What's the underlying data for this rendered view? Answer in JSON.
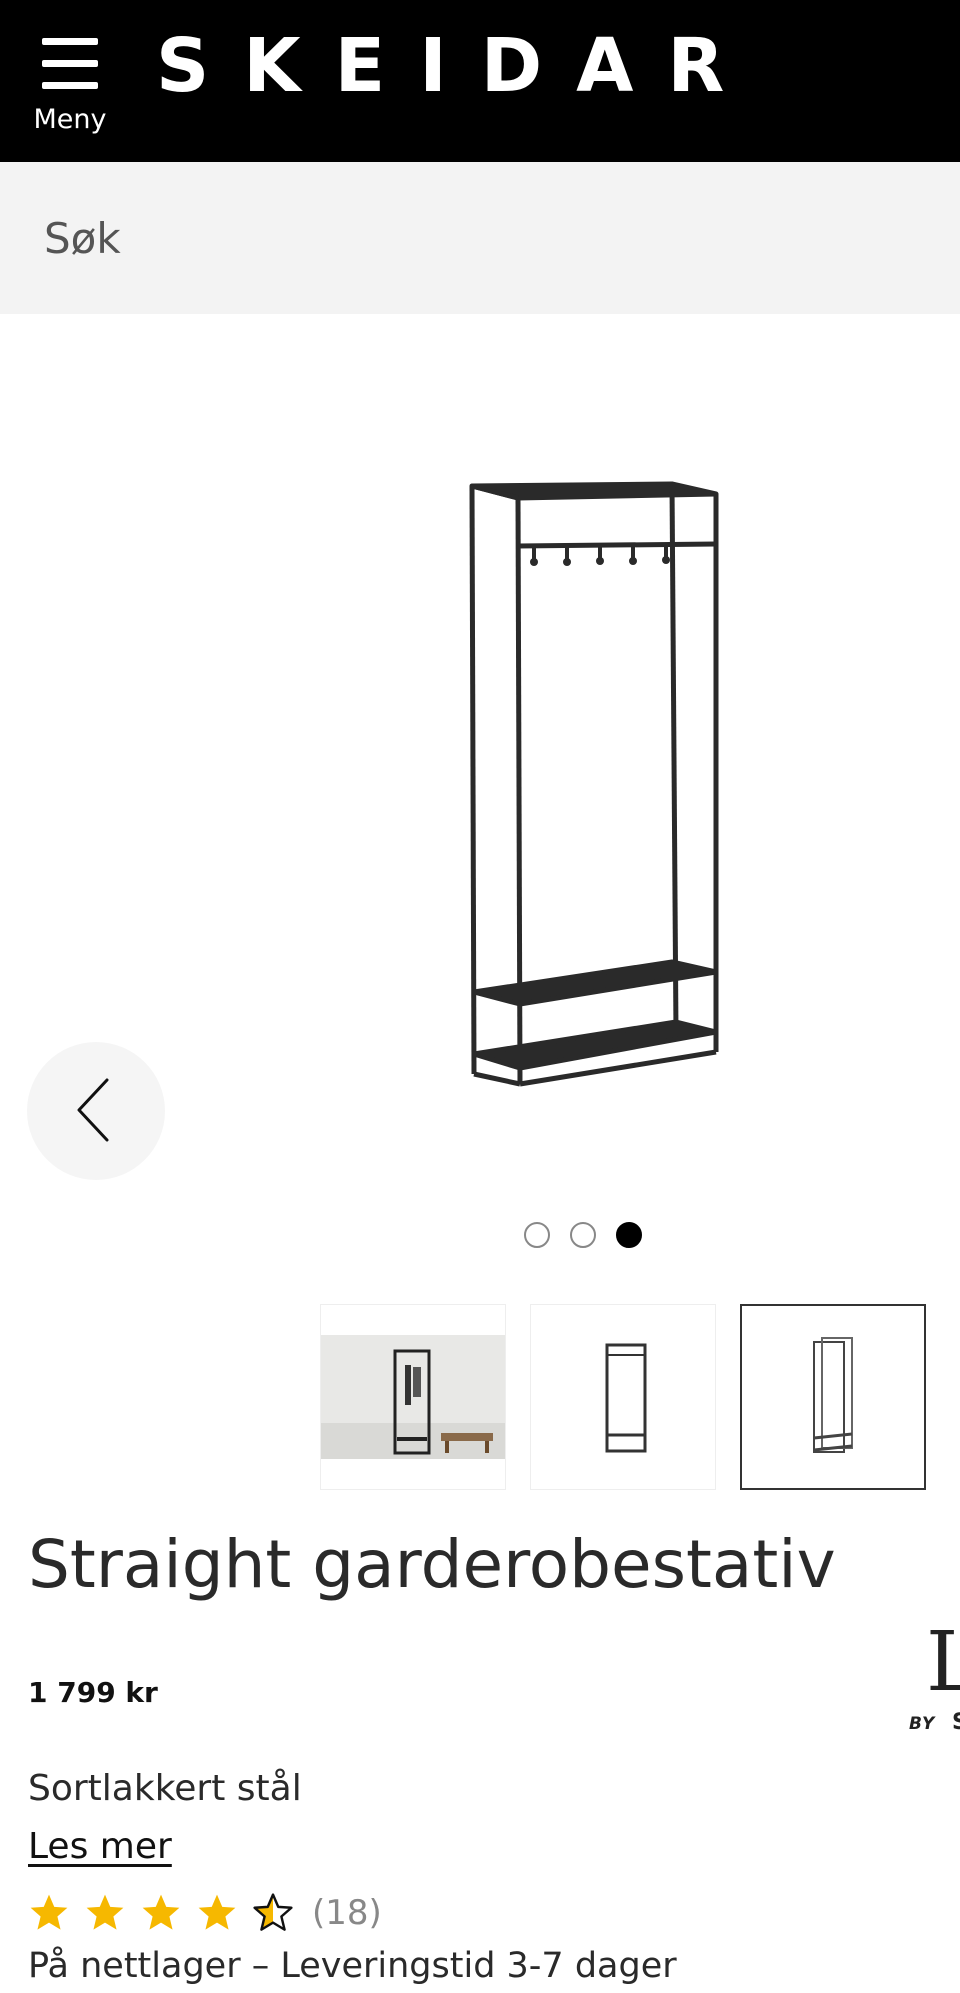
{
  "header": {
    "menu_label": "Meny",
    "logo": "SKEIDAR",
    "background": "#000000",
    "text_color": "#ffffff"
  },
  "search": {
    "placeholder": "Søk",
    "background": "#f3f3f3"
  },
  "gallery": {
    "image_count": 3,
    "active_index": 3,
    "prev_icon": "chevron-left-icon",
    "thumbnails": [
      {
        "name": "thumb-room-scene",
        "selected": false
      },
      {
        "name": "thumb-front-view",
        "selected": false
      },
      {
        "name": "thumb-angled-view",
        "selected": true
      }
    ]
  },
  "product": {
    "title": "Straight garderobestativ",
    "price": "1 799 kr",
    "material": "Sortlakkert stål",
    "read_more": "Les mer",
    "rating_value": 4.5,
    "rating_max": 5,
    "review_count": "(18)",
    "star_color": "#f6b800",
    "stock": "På nettlager – Leveringstid 3-7 dager"
  },
  "brand": {
    "letter": "L",
    "by": "BY",
    "s": "S"
  }
}
